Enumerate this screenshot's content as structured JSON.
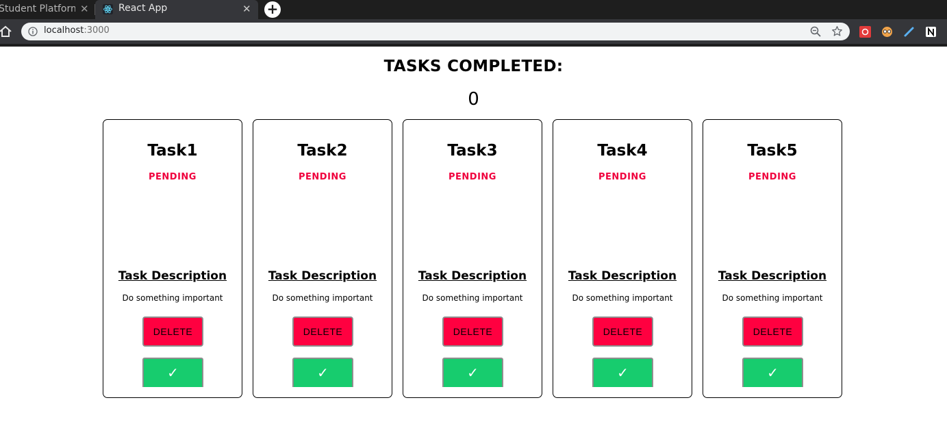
{
  "browser": {
    "inactive_tab_title": "Student Platform",
    "active_tab_title": "React App",
    "close_glyph": "✕",
    "new_tab_glyph": "+",
    "url_host": "localhost",
    "url_port": ":3000"
  },
  "page": {
    "heading": "TASKS COMPLETED:",
    "completed_count": "0"
  },
  "tasks": [
    {
      "title": "Task1",
      "status": "PENDING",
      "desc_title": "Task Description",
      "desc": "Do something important",
      "delete_label": "DELETE",
      "done_label": "✓"
    },
    {
      "title": "Task2",
      "status": "PENDING",
      "desc_title": "Task Description",
      "desc": "Do something important",
      "delete_label": "DELETE",
      "done_label": "✓"
    },
    {
      "title": "Task3",
      "status": "PENDING",
      "desc_title": "Task Description",
      "desc": "Do something important",
      "delete_label": "DELETE",
      "done_label": "✓"
    },
    {
      "title": "Task4",
      "status": "PENDING",
      "desc_title": "Task Description",
      "desc": "Do something important",
      "delete_label": "DELETE",
      "done_label": "✓"
    },
    {
      "title": "Task5",
      "status": "PENDING",
      "desc_title": "Task Description",
      "desc": "Do something important",
      "delete_label": "DELETE",
      "done_label": "✓"
    }
  ],
  "colors": {
    "pending": "#f0003d",
    "delete_button": "#ff0040",
    "done_button": "#17cc6e"
  }
}
